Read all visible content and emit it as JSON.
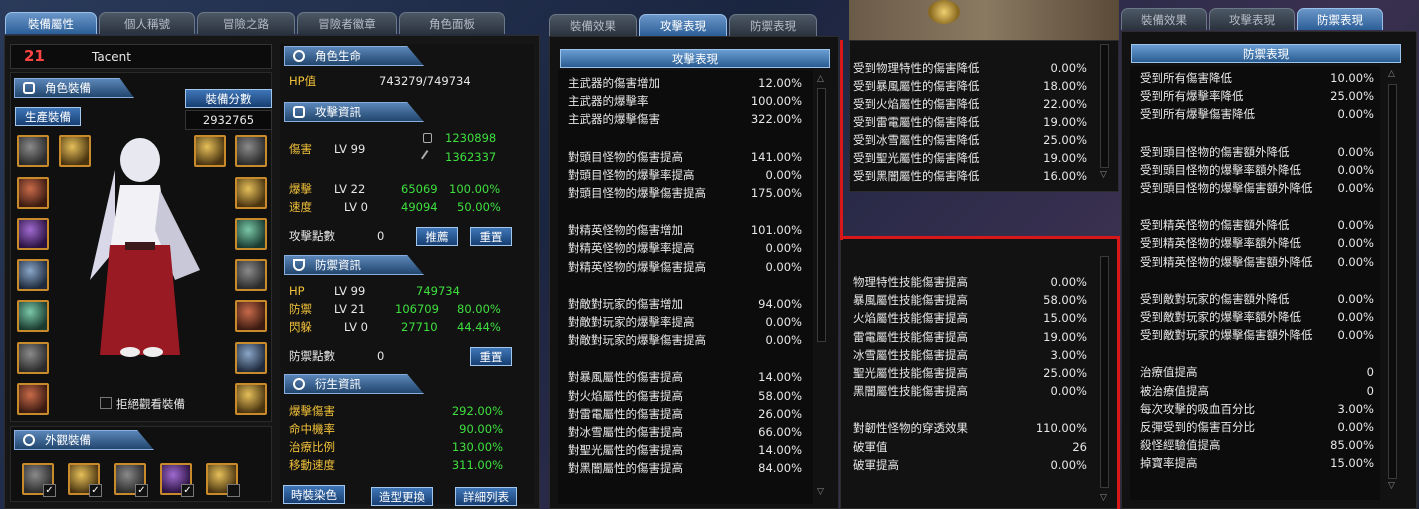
{
  "colors": {
    "accent": "#2b5e97",
    "stat_yellow": "#f2c23a",
    "stat_green": "#3ee03e",
    "red_marker": "#d81818"
  },
  "left_window": {
    "tabs": [
      "裝備屬性",
      "個人稱號",
      "冒險之路",
      "冒險者徽章",
      "角色面板"
    ],
    "active_tab": 0,
    "character": {
      "level": "21",
      "name": "Tacent"
    },
    "equip_section": "角色裝備",
    "craft_button": "生產裝備",
    "score_button": "裝備分數",
    "score_value": "2932765",
    "refuse_view": "拒絕觀看裝備",
    "appearance_section": "外觀裝備",
    "buttons": {
      "dye": "時裝染色",
      "style": "造型更換",
      "detail": "詳細列表"
    }
  },
  "stats": {
    "life": {
      "header": "角色生命",
      "hp_label": "HP值",
      "hp_value": "743279/749734"
    },
    "attack": {
      "header": "攻擊資訊",
      "damage_label": "傷害",
      "damage_lv": "LV 99",
      "damage_main": "1230898",
      "damage_sub": "1362337",
      "crit_label": "爆擊",
      "crit_lv": "LV 22",
      "crit_value": "65069",
      "crit_pct": "100.00%",
      "speed_label": "速度",
      "speed_lv": "LV 0",
      "speed_value": "49094",
      "speed_pct": "50.00%",
      "points_label": "攻擊點數",
      "points_value": "0",
      "recommend": "推薦",
      "reset": "重置"
    },
    "defense": {
      "header": "防禦資訊",
      "hp_label": "HP",
      "hp_lv": "LV 99",
      "hp_value": "749734",
      "def_label": "防禦",
      "def_lv": "LV 21",
      "def_value": "106709",
      "def_pct": "80.00%",
      "eva_label": "閃躲",
      "eva_lv": "LV 0",
      "eva_value": "27710",
      "eva_pct": "44.44%",
      "points_label": "防禦點數",
      "points_value": "0",
      "reset": "重置"
    },
    "derived": {
      "header": "衍生資訊",
      "rows": [
        {
          "label": "爆擊傷害",
          "value": "292.00%"
        },
        {
          "label": "命中機率",
          "value": "90.00%"
        },
        {
          "label": "治療比例",
          "value": "130.00%"
        },
        {
          "label": "移動速度",
          "value": "311.00%"
        }
      ]
    }
  },
  "attack_window": {
    "tabs": [
      "裝備效果",
      "攻擊表現",
      "防禦表現"
    ],
    "active_tab": 1,
    "header": "攻擊表現",
    "groups": [
      [
        {
          "label": "主武器的傷害增加",
          "value": "12.00%"
        },
        {
          "label": "主武器的爆擊率",
          "value": "100.00%"
        },
        {
          "label": "主武器的爆擊傷害",
          "value": "322.00%"
        }
      ],
      [
        {
          "label": "對頭目怪物的傷害提高",
          "value": "141.00%"
        },
        {
          "label": "對頭目怪物的爆擊率提高",
          "value": "0.00%"
        },
        {
          "label": "對頭目怪物的爆擊傷害提高",
          "value": "175.00%"
        }
      ],
      [
        {
          "label": "對精英怪物的傷害增加",
          "value": "101.00%"
        },
        {
          "label": "對精英怪物的爆擊率提高",
          "value": "0.00%"
        },
        {
          "label": "對精英怪物的爆擊傷害提高",
          "value": "0.00%"
        }
      ],
      [
        {
          "label": "對敵對玩家的傷害增加",
          "value": "94.00%"
        },
        {
          "label": "對敵對玩家的爆擊率提高",
          "value": "0.00%"
        },
        {
          "label": "對敵對玩家的爆擊傷害提高",
          "value": "0.00%"
        }
      ],
      [
        {
          "label": "對暴風屬性的傷害提高",
          "value": "14.00%"
        },
        {
          "label": "對火焰屬性的傷害提高",
          "value": "58.00%"
        },
        {
          "label": "對雷電屬性的傷害提高",
          "value": "26.00%"
        },
        {
          "label": "對冰雪屬性的傷害提高",
          "value": "66.00%"
        },
        {
          "label": "對聖光屬性的傷害提高",
          "value": "14.00%"
        },
        {
          "label": "對黑闇屬性的傷害提高",
          "value": "84.00%"
        }
      ]
    ]
  },
  "mid_top": {
    "rows": [
      {
        "label": "受到物理特性的傷害降低",
        "value": "0.00%"
      },
      {
        "label": "受到暴風屬性的傷害降低",
        "value": "18.00%"
      },
      {
        "label": "受到火焰屬性的傷害降低",
        "value": "22.00%"
      },
      {
        "label": "受到雷電屬性的傷害降低",
        "value": "19.00%"
      },
      {
        "label": "受到冰雪屬性的傷害降低",
        "value": "25.00%"
      },
      {
        "label": "受到聖光屬性的傷害降低",
        "value": "19.00%"
      },
      {
        "label": "受到黑闇屬性的傷害降低",
        "value": "16.00%"
      }
    ]
  },
  "mid_bottom": {
    "groups": [
      [
        {
          "label": "物理特性技能傷害提高",
          "value": "0.00%"
        },
        {
          "label": "暴風屬性技能傷害提高",
          "value": "58.00%"
        },
        {
          "label": "火焰屬性技能傷害提高",
          "value": "15.00%"
        },
        {
          "label": "雷電屬性技能傷害提高",
          "value": "19.00%"
        },
        {
          "label": "冰雪屬性技能傷害提高",
          "value": "3.00%"
        },
        {
          "label": "聖光屬性技能傷害提高",
          "value": "25.00%"
        },
        {
          "label": "黑闇屬性技能傷害提高",
          "value": "0.00%"
        }
      ],
      [
        {
          "label": "對韌性怪物的穿透效果",
          "value": "110.00%"
        },
        {
          "label": "破軍值",
          "value": "26"
        },
        {
          "label": "破軍提高",
          "value": "0.00%"
        }
      ]
    ]
  },
  "defense_window": {
    "tabs": [
      "裝備效果",
      "攻擊表現",
      "防禦表現"
    ],
    "active_tab": 2,
    "header": "防禦表現",
    "groups": [
      [
        {
          "label": "受到所有傷害降低",
          "value": "10.00%"
        },
        {
          "label": "受到所有爆擊率降低",
          "value": "25.00%"
        },
        {
          "label": "受到所有爆擊傷害降低",
          "value": "0.00%"
        }
      ],
      [
        {
          "label": "受到頭目怪物的傷害額外降低",
          "value": "0.00%"
        },
        {
          "label": "受到頭目怪物的爆擊率額外降低",
          "value": "0.00%"
        },
        {
          "label": "受到頭目怪物的爆擊傷害額外降低",
          "value": "0.00%"
        }
      ],
      [
        {
          "label": "受到精英怪物的傷害額外降低",
          "value": "0.00%"
        },
        {
          "label": "受到精英怪物的爆擊率額外降低",
          "value": "0.00%"
        },
        {
          "label": "受到精英怪物的爆擊傷害額外降低",
          "value": "0.00%"
        }
      ],
      [
        {
          "label": "受到敵對玩家的傷害額外降低",
          "value": "0.00%"
        },
        {
          "label": "受到敵對玩家的爆擊率額外降低",
          "value": "0.00%"
        },
        {
          "label": "受到敵對玩家的爆擊傷害額外降低",
          "value": "0.00%"
        }
      ],
      [
        {
          "label": "治療值提高",
          "value": "0"
        },
        {
          "label": "被治療值提高",
          "value": "0"
        },
        {
          "label": "每次攻擊的吸血百分比",
          "value": "3.00%"
        },
        {
          "label": "反彈受到的傷害百分比",
          "value": "0.00%"
        },
        {
          "label": "殺怪經驗值提高",
          "value": "85.00%"
        },
        {
          "label": "掉寶率提高",
          "value": "15.00%"
        }
      ]
    ]
  }
}
